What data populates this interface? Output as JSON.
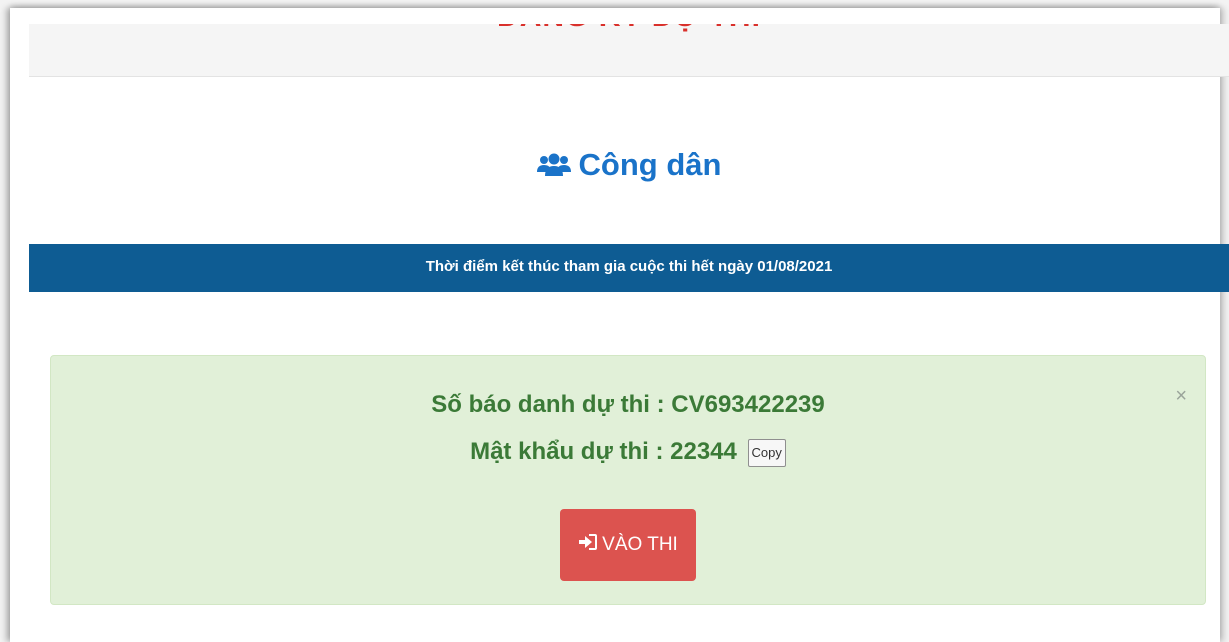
{
  "header": {
    "title": "ĐĂNG KÝ DỰ THI"
  },
  "page": {
    "heading": "Công dân",
    "heading_icon": "users-icon"
  },
  "deadline": {
    "text": "Thời điểm kết thúc tham gia cuộc thi hết ngày 01/08/2021"
  },
  "result_alert": {
    "close_label": "×",
    "candidate_line": "Số báo danh dự thi : CV693422239",
    "password_line": "Mật khẩu dự thi : 22344",
    "copy_label": "Copy",
    "enter_label": "VÀO THI",
    "enter_icon": "sign-in-icon"
  },
  "colors": {
    "header_title": "#d9302b",
    "heading": "#1a73c9",
    "deadline_bar": "#0e5c93",
    "alert_bg": "#e1f0d8",
    "alert_text": "#3b7a37",
    "enter_button": "#dc534f"
  }
}
